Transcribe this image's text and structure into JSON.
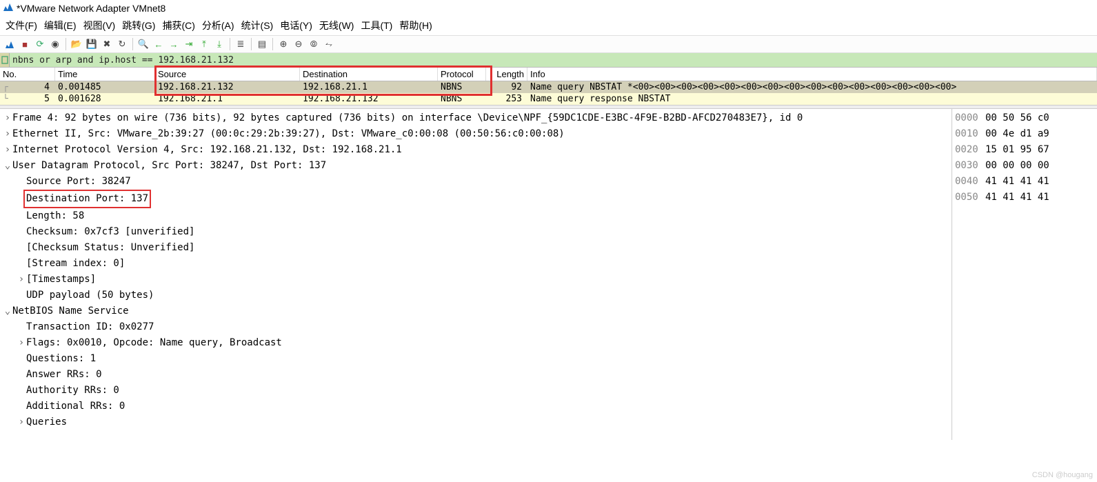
{
  "window": {
    "title": "*VMware Network Adapter VMnet8"
  },
  "menu": {
    "file": "文件(F)",
    "edit": "编辑(E)",
    "view": "视图(V)",
    "go": "跳转(G)",
    "capture": "捕获(C)",
    "analyze": "分析(A)",
    "stats": "统计(S)",
    "telephony": "电话(Y)",
    "wireless": "无线(W)",
    "tools": "工具(T)",
    "help": "帮助(H)"
  },
  "filter": {
    "value": "nbns or arp and ip.host == 192.168.21.132"
  },
  "columns": {
    "no": "No.",
    "time": "Time",
    "source": "Source",
    "destination": "Destination",
    "protocol": "Protocol",
    "length": "Length",
    "info": "Info"
  },
  "packets": [
    {
      "no": "4",
      "time": "0.001485",
      "src": "192.168.21.132",
      "dst": "192.168.21.1",
      "proto": "NBNS",
      "len": "92",
      "info": "Name query NBSTAT *<00><00><00><00><00><00><00><00><00><00><00><00><00><00><00>",
      "selected": true
    },
    {
      "no": "5",
      "time": "0.001628",
      "src": "192.168.21.1",
      "dst": "192.168.21.132",
      "proto": "NBNS",
      "len": "253",
      "info": "Name query response NBSTAT",
      "selected": false
    }
  ],
  "details": {
    "frame": "Frame 4: 92 bytes on wire (736 bits), 92 bytes captured (736 bits) on interface \\Device\\NPF_{59DC1CDE-E3BC-4F9E-B2BD-AFCD270483E7}, id 0",
    "eth": "Ethernet II, Src: VMware_2b:39:27 (00:0c:29:2b:39:27), Dst: VMware_c0:00:08 (00:50:56:c0:00:08)",
    "ip": "Internet Protocol Version 4, Src: 192.168.21.132, Dst: 192.168.21.1",
    "udp": "User Datagram Protocol, Src Port: 38247, Dst Port: 137",
    "udp_items": {
      "srcport": "Source Port: 38247",
      "dstport": "Destination Port: 137",
      "length": "Length: 58",
      "checksum": "Checksum: 0x7cf3 [unverified]",
      "ckstatus": "[Checksum Status: Unverified]",
      "stream": "[Stream index: 0]",
      "timestamps": "[Timestamps]",
      "payload": "UDP payload (50 bytes)"
    },
    "nbns": "NetBIOS Name Service",
    "nbns_items": {
      "txid": "Transaction ID: 0x0277",
      "flags": "Flags: 0x0010, Opcode: Name query, Broadcast",
      "questions": "Questions: 1",
      "answer": "Answer RRs: 0",
      "authority": "Authority RRs: 0",
      "additional": "Additional RRs: 0",
      "queries": "Queries"
    }
  },
  "hex": [
    {
      "off": "0000",
      "b": "00 50 56 c0"
    },
    {
      "off": "0010",
      "b": "00 4e d1 a9"
    },
    {
      "off": "0020",
      "b": "15 01 95 67"
    },
    {
      "off": "0030",
      "b": "00 00 00 00"
    },
    {
      "off": "0040",
      "b": "41 41 41 41"
    },
    {
      "off": "0050",
      "b": "41 41 41 41"
    }
  ],
  "watermark": "CSDN @hougang"
}
